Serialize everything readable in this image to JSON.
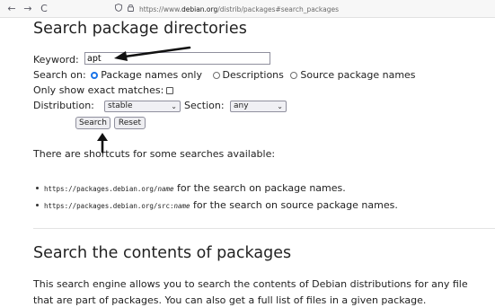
{
  "browser": {
    "back_icon": "←",
    "forward_icon": "→",
    "reload_icon": "C",
    "url_prefix": "https://www.",
    "url_domain": "debian.org",
    "url_path": "/distrib/packages#search_packages"
  },
  "page": {
    "heading": "Search package directories",
    "keyword_label": "Keyword:",
    "keyword_value": "apt",
    "search_on_label": "Search on:",
    "search_on_options": [
      "Package names only",
      "Descriptions",
      "Source package names"
    ],
    "search_on_selected": "Package names only",
    "exact_matches_label": "Only show exact matches:",
    "distribution_label": "Distribution:",
    "distribution_value": "stable",
    "section_label": "Section:",
    "section_value": "any",
    "search_button": "Search",
    "reset_button": "Reset",
    "shortcuts_intro": "There are shortcuts for some searches available:",
    "shortcuts": [
      {
        "url": "https://packages.debian.org/",
        "url_var": "name",
        "text": " for the search on package names."
      },
      {
        "url": "https://packages.debian.org/src:",
        "url_var": "name",
        "text": " for the search on source package names."
      }
    ],
    "contents_heading": "Search the contents of packages",
    "contents_line1": "This search engine allows you to search the contents of Debian distributions for any file",
    "contents_line2": "that are part of packages. You can also get a full list of files in a given package."
  }
}
